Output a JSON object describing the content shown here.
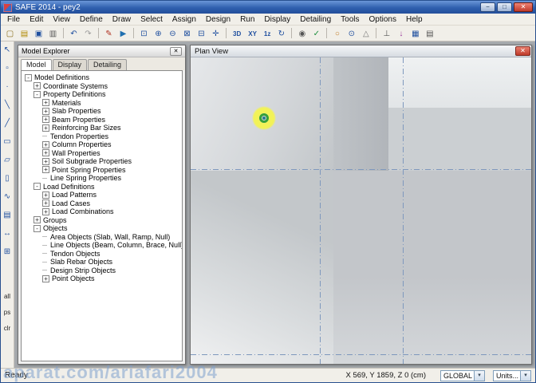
{
  "title_bar": {
    "title": "SAFE 2014 - pey2",
    "buttons": [
      {
        "name": "minimize-button",
        "glyph": "−"
      },
      {
        "name": "maximize-button",
        "glyph": "□"
      },
      {
        "name": "close-button",
        "glyph": "✕",
        "close": true
      }
    ]
  },
  "menu": {
    "items": [
      "File",
      "Edit",
      "View",
      "Define",
      "Draw",
      "Select",
      "Assign",
      "Design",
      "Run",
      "Display",
      "Detailing",
      "Tools",
      "Options",
      "Help"
    ]
  },
  "toolbar": {
    "items": [
      {
        "name": "new-model-icon",
        "glyph": "▢",
        "color": "#8a6d1a"
      },
      {
        "name": "open-model-icon",
        "glyph": "▤",
        "color": "#b08900"
      },
      {
        "name": "save-model-icon",
        "glyph": "▣",
        "color": "#1f4f9f"
      },
      {
        "name": "print-icon",
        "glyph": "▥",
        "color": "#555555"
      },
      {
        "sep": true
      },
      {
        "name": "undo-icon",
        "glyph": "↶",
        "color": "#1f4f9f"
      },
      {
        "name": "redo-icon",
        "glyph": "↷",
        "color": "#9a9a9a"
      },
      {
        "sep": true
      },
      {
        "name": "draw-mode-icon",
        "glyph": "✎",
        "color": "#b03020"
      },
      {
        "name": "run-analysis-icon",
        "glyph": "▶",
        "color": "#1f6faf"
      },
      {
        "sep": true
      },
      {
        "name": "rubber-band-zoom-icon",
        "glyph": "⊡",
        "color": "#1f4f9f"
      },
      {
        "name": "zoom-in-icon",
        "glyph": "⊕",
        "color": "#1f4f9f"
      },
      {
        "name": "zoom-out-icon",
        "glyph": "⊖",
        "color": "#1f4f9f"
      },
      {
        "name": "zoom-full-icon",
        "glyph": "⊠",
        "color": "#1f4f9f"
      },
      {
        "name": "zoom-previous-icon",
        "glyph": "⊟",
        "color": "#1f4f9f"
      },
      {
        "name": "pan-icon",
        "glyph": "✛",
        "color": "#1f4f9f"
      },
      {
        "sep": true
      },
      {
        "name": "view-3d-button",
        "text": "3D"
      },
      {
        "name": "view-plan-button",
        "text": "XY"
      },
      {
        "name": "view-elevation-button",
        "text": "1z"
      },
      {
        "name": "rotate-view-icon",
        "glyph": "↻",
        "color": "#1f4f9f"
      },
      {
        "sep": true
      },
      {
        "name": "object-viewer-icon",
        "glyph": "◉",
        "color": "#555555"
      },
      {
        "name": "check-model-icon",
        "glyph": "✓",
        "color": "#1f8f3f"
      },
      {
        "sep": true
      },
      {
        "name": "snap-circle-icon",
        "glyph": "○",
        "color": "#c07820"
      },
      {
        "name": "snap-target-icon",
        "glyph": "⊙",
        "color": "#1f4f9f"
      },
      {
        "name": "snap-triangle-icon",
        "glyph": "△",
        "color": "#777777"
      },
      {
        "sep": true
      },
      {
        "name": "support-icon",
        "glyph": "⊥",
        "color": "#555555"
      },
      {
        "name": "point-load-icon",
        "glyph": "↓",
        "color": "#9a3a9a"
      },
      {
        "name": "grid-options-icon",
        "glyph": "▦",
        "color": "#1f4f9f"
      },
      {
        "name": "tables-icon",
        "glyph": "▤",
        "color": "#555555"
      }
    ]
  },
  "side_toolbar": {
    "items": [
      {
        "name": "select-pointer-icon",
        "glyph": "↖"
      },
      {
        "name": "reshape-object-icon",
        "glyph": "▫"
      },
      {
        "name": "draw-point-icon",
        "glyph": "∙"
      },
      {
        "name": "draw-line-icon",
        "glyph": "╲"
      },
      {
        "name": "quick-draw-line-icon",
        "glyph": "╱"
      },
      {
        "name": "draw-area-icon",
        "glyph": "▭"
      },
      {
        "name": "quick-draw-area-icon",
        "glyph": "▱"
      },
      {
        "name": "draw-rectangle-icon",
        "glyph": "▯"
      },
      {
        "name": "draw-tendon-icon",
        "glyph": "∿"
      },
      {
        "name": "draw-design-strip-icon",
        "glyph": "▤"
      },
      {
        "name": "draw-dimension-line-icon",
        "glyph": "↔"
      },
      {
        "name": "snap-grid-icon",
        "glyph": "⊞"
      },
      {
        "spacer": 26
      },
      {
        "name": "snap-all-button",
        "label": "all"
      },
      {
        "name": "snap-points-button",
        "label": "ps"
      },
      {
        "name": "snap-clear-button",
        "label": "clr"
      }
    ]
  },
  "model_explorer": {
    "title": "Model Explorer",
    "close_glyph": "✕",
    "tabs": [
      "Model",
      "Display",
      "Detailing"
    ],
    "active_tab": 0,
    "tree": [
      {
        "label": "Model Definitions",
        "level": 0,
        "exp": "minus"
      },
      {
        "label": "Coordinate Systems",
        "level": 1,
        "exp": "plus"
      },
      {
        "label": "Property Definitions",
        "level": 1,
        "exp": "minus"
      },
      {
        "label": "Materials",
        "level": 2,
        "exp": "plus"
      },
      {
        "label": "Slab Properties",
        "level": 2,
        "exp": "plus"
      },
      {
        "label": "Beam Properties",
        "level": 2,
        "exp": "plus"
      },
      {
        "label": "Reinforcing Bar Sizes",
        "level": 2,
        "exp": "plus"
      },
      {
        "label": "Tendon Properties",
        "level": 2,
        "exp": "none"
      },
      {
        "label": "Column Properties",
        "level": 2,
        "exp": "plus"
      },
      {
        "label": "Wall Properties",
        "level": 2,
        "exp": "plus"
      },
      {
        "label": "Soil Subgrade Properties",
        "level": 2,
        "exp": "plus"
      },
      {
        "label": "Point Spring Properties",
        "level": 2,
        "exp": "plus"
      },
      {
        "label": "Line Spring Properties",
        "level": 2,
        "exp": "none"
      },
      {
        "label": "Load Definitions",
        "level": 1,
        "exp": "minus"
      },
      {
        "label": "Load Patterns",
        "level": 2,
        "exp": "plus"
      },
      {
        "label": "Load Cases",
        "level": 2,
        "exp": "plus"
      },
      {
        "label": "Load Combinations",
        "level": 2,
        "exp": "plus"
      },
      {
        "label": "Groups",
        "level": 1,
        "exp": "plus"
      },
      {
        "label": "Objects",
        "level": 1,
        "exp": "minus"
      },
      {
        "label": "Area Objects (Slab, Wall, Ramp, Null)",
        "level": 2,
        "exp": "none"
      },
      {
        "label": "Line Objects (Beam, Column, Brace, Null)",
        "level": 2,
        "exp": "none"
      },
      {
        "label": "Tendon Objects",
        "level": 2,
        "exp": "none"
      },
      {
        "label": "Slab Rebar Objects",
        "level": 2,
        "exp": "none"
      },
      {
        "label": "Design Strip Objects",
        "level": 2,
        "exp": "none"
      },
      {
        "label": "Point Objects",
        "level": 2,
        "exp": "plus"
      }
    ]
  },
  "plan_view": {
    "title": "Plan View",
    "close_glyph": "✕"
  },
  "status_bar": {
    "ready": "Ready",
    "coords": "X 569, Y 1859, Z 0 (cm)",
    "global_label": "GLOBAL",
    "units_label": "Units...",
    "dropdown_glyph": "▾"
  },
  "watermark": {
    "text": "aparat.com/ariafari2004"
  }
}
